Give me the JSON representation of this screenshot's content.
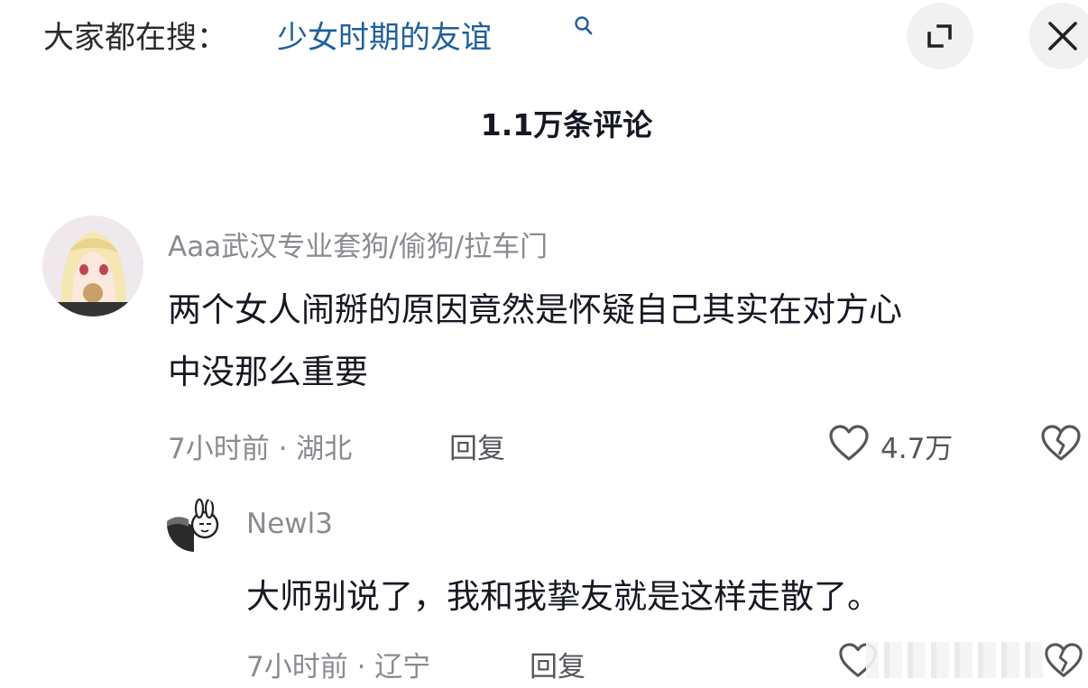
{
  "search_bar": {
    "prefix": "大家都在搜：",
    "term": "少女时期的友谊"
  },
  "icons": {
    "search": "search-icon",
    "expand": "expand-icon",
    "close": "close-icon",
    "like": "heart-icon",
    "dislike": "broken-heart-icon"
  },
  "colors": {
    "search_term": "#1f5f9e",
    "text_primary": "#161823",
    "text_secondary": "#8a8b91"
  },
  "header": {
    "comment_count": "1.1万条评论"
  },
  "comment": {
    "username": "Aaa武汉专业套狗/偷狗/拉车门",
    "text_line1": "两个女人闹掰的原因竟然是怀疑自己其实在对方心",
    "text_line2": "中没那么重要",
    "time_location": "7小时前 · 湖北",
    "reply_label": "回复",
    "like_count": "4.7万"
  },
  "reply": {
    "username": "Newl3",
    "text": "大师别说了，我和我挚友就是这样走散了。",
    "time_location": "7小时前 · 辽宁",
    "reply_label": "回复"
  }
}
